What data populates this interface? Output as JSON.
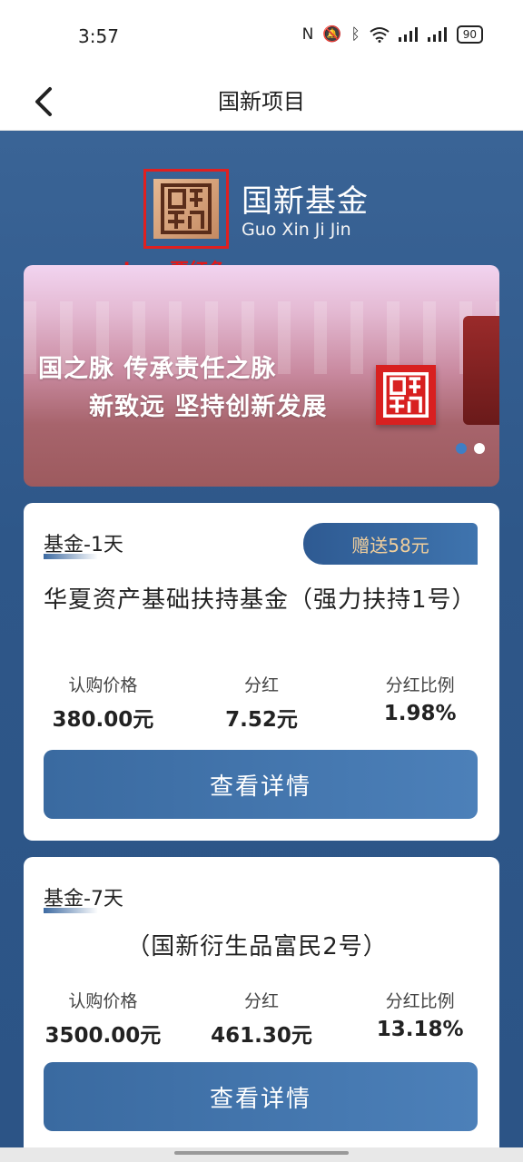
{
  "status_bar": {
    "time": "3:57",
    "battery": "90",
    "icons": [
      "nfc-icon",
      "mute-icon",
      "bluetooth-icon",
      "wifi-icon",
      "signal-icon",
      "signal-icon",
      "battery-icon"
    ]
  },
  "nav": {
    "title": "国新项目",
    "back_icon": "chevron-left-icon"
  },
  "brand": {
    "name": "国新基金",
    "pinyin": "Guo Xin Ji Jin",
    "logo_note": "logo要红色"
  },
  "banner": {
    "line1": "国之脉 传承责任之脉",
    "line2": "新致远 坚持创新发展",
    "active_slide": 1,
    "slide_count": 2
  },
  "funds": [
    {
      "tag": "基金-1天",
      "badge": "赠送58元",
      "title": "华夏资产基础扶持基金（强力扶持1号）",
      "stats": [
        {
          "label": "认购价格",
          "value": "380.00元"
        },
        {
          "label": "分红",
          "value": "7.52元"
        },
        {
          "label": "分红比例",
          "value": "1.98%"
        }
      ],
      "button": "查看详情"
    },
    {
      "tag": "基金-7天",
      "title": "（国新衍生品富民2号）",
      "stats": [
        {
          "label": "认购价格",
          "value": "3500.00元"
        },
        {
          "label": "分红",
          "value": "461.30元"
        },
        {
          "label": "分红比例",
          "value": "13.18%"
        }
      ],
      "button": "查看详情"
    }
  ],
  "colors": {
    "primary_blue": "#2e5789",
    "button_blue": "#3a6aa0",
    "badge_gold": "#f2cf9c",
    "logo_red": "#d82020",
    "annotation_red": "#e51818"
  }
}
